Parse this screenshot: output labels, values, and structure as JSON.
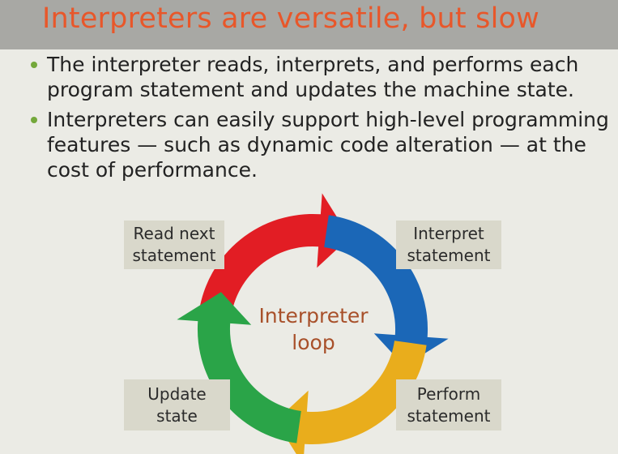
{
  "title": "Interpreters are versatile, but slow",
  "bullets": [
    "The interpreter reads, interprets, and performs each program statement and updates the machine state.",
    "Interpreters can easily support high-level programming features — such as dynamic code alteration — at the cost of performance."
  ],
  "diagram": {
    "center_label": "Interpreter\nloop",
    "steps": [
      {
        "label": "Read next\nstatement",
        "color": "#e21d24"
      },
      {
        "label": "Interpret\nstatement",
        "color": "#1b67b7"
      },
      {
        "label": "Perform\nstatement",
        "color": "#e9ad1c"
      },
      {
        "label": "Update\nstate",
        "color": "#2aa448"
      }
    ]
  },
  "colors": {
    "title_text": "#e8572a",
    "title_bar": "#a8a8a4",
    "background": "#ebebe5",
    "bullet_dot": "#74a83b",
    "label_box": "#d9d8cb",
    "center_text": "#a8502a"
  }
}
